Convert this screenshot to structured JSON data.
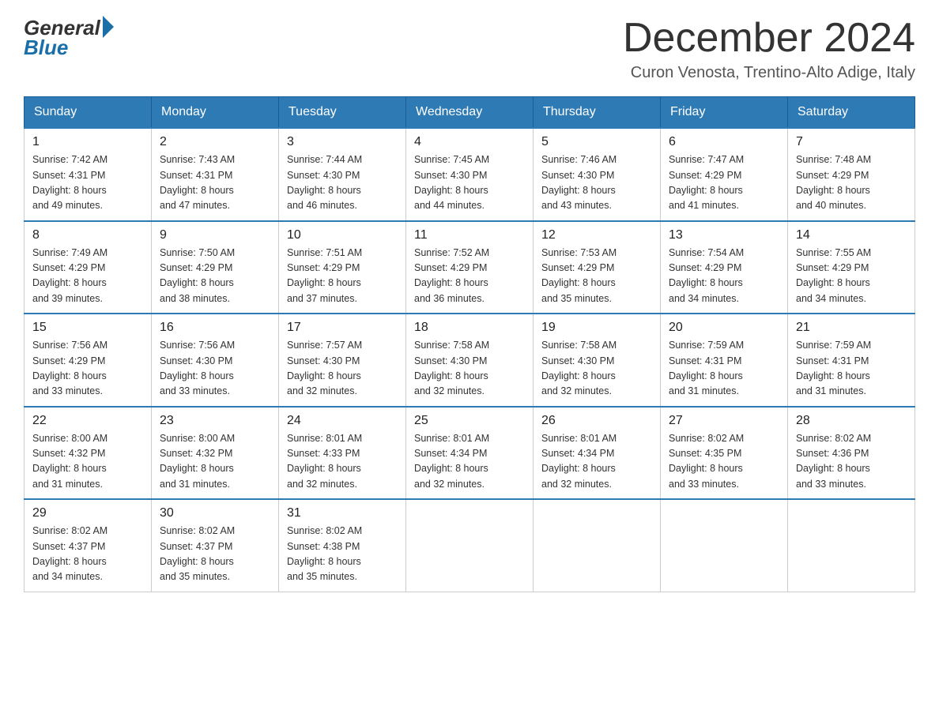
{
  "logo": {
    "general": "General",
    "blue": "Blue"
  },
  "title": {
    "month_year": "December 2024",
    "location": "Curon Venosta, Trentino-Alto Adige, Italy"
  },
  "headers": [
    "Sunday",
    "Monday",
    "Tuesday",
    "Wednesday",
    "Thursday",
    "Friday",
    "Saturday"
  ],
  "weeks": [
    [
      {
        "day": "1",
        "sunrise": "7:42 AM",
        "sunset": "4:31 PM",
        "daylight": "8 hours and 49 minutes."
      },
      {
        "day": "2",
        "sunrise": "7:43 AM",
        "sunset": "4:31 PM",
        "daylight": "8 hours and 47 minutes."
      },
      {
        "day": "3",
        "sunrise": "7:44 AM",
        "sunset": "4:30 PM",
        "daylight": "8 hours and 46 minutes."
      },
      {
        "day": "4",
        "sunrise": "7:45 AM",
        "sunset": "4:30 PM",
        "daylight": "8 hours and 44 minutes."
      },
      {
        "day": "5",
        "sunrise": "7:46 AM",
        "sunset": "4:30 PM",
        "daylight": "8 hours and 43 minutes."
      },
      {
        "day": "6",
        "sunrise": "7:47 AM",
        "sunset": "4:29 PM",
        "daylight": "8 hours and 41 minutes."
      },
      {
        "day": "7",
        "sunrise": "7:48 AM",
        "sunset": "4:29 PM",
        "daylight": "8 hours and 40 minutes."
      }
    ],
    [
      {
        "day": "8",
        "sunrise": "7:49 AM",
        "sunset": "4:29 PM",
        "daylight": "8 hours and 39 minutes."
      },
      {
        "day": "9",
        "sunrise": "7:50 AM",
        "sunset": "4:29 PM",
        "daylight": "8 hours and 38 minutes."
      },
      {
        "day": "10",
        "sunrise": "7:51 AM",
        "sunset": "4:29 PM",
        "daylight": "8 hours and 37 minutes."
      },
      {
        "day": "11",
        "sunrise": "7:52 AM",
        "sunset": "4:29 PM",
        "daylight": "8 hours and 36 minutes."
      },
      {
        "day": "12",
        "sunrise": "7:53 AM",
        "sunset": "4:29 PM",
        "daylight": "8 hours and 35 minutes."
      },
      {
        "day": "13",
        "sunrise": "7:54 AM",
        "sunset": "4:29 PM",
        "daylight": "8 hours and 34 minutes."
      },
      {
        "day": "14",
        "sunrise": "7:55 AM",
        "sunset": "4:29 PM",
        "daylight": "8 hours and 34 minutes."
      }
    ],
    [
      {
        "day": "15",
        "sunrise": "7:56 AM",
        "sunset": "4:29 PM",
        "daylight": "8 hours and 33 minutes."
      },
      {
        "day": "16",
        "sunrise": "7:56 AM",
        "sunset": "4:30 PM",
        "daylight": "8 hours and 33 minutes."
      },
      {
        "day": "17",
        "sunrise": "7:57 AM",
        "sunset": "4:30 PM",
        "daylight": "8 hours and 32 minutes."
      },
      {
        "day": "18",
        "sunrise": "7:58 AM",
        "sunset": "4:30 PM",
        "daylight": "8 hours and 32 minutes."
      },
      {
        "day": "19",
        "sunrise": "7:58 AM",
        "sunset": "4:30 PM",
        "daylight": "8 hours and 32 minutes."
      },
      {
        "day": "20",
        "sunrise": "7:59 AM",
        "sunset": "4:31 PM",
        "daylight": "8 hours and 31 minutes."
      },
      {
        "day": "21",
        "sunrise": "7:59 AM",
        "sunset": "4:31 PM",
        "daylight": "8 hours and 31 minutes."
      }
    ],
    [
      {
        "day": "22",
        "sunrise": "8:00 AM",
        "sunset": "4:32 PM",
        "daylight": "8 hours and 31 minutes."
      },
      {
        "day": "23",
        "sunrise": "8:00 AM",
        "sunset": "4:32 PM",
        "daylight": "8 hours and 31 minutes."
      },
      {
        "day": "24",
        "sunrise": "8:01 AM",
        "sunset": "4:33 PM",
        "daylight": "8 hours and 32 minutes."
      },
      {
        "day": "25",
        "sunrise": "8:01 AM",
        "sunset": "4:34 PM",
        "daylight": "8 hours and 32 minutes."
      },
      {
        "day": "26",
        "sunrise": "8:01 AM",
        "sunset": "4:34 PM",
        "daylight": "8 hours and 32 minutes."
      },
      {
        "day": "27",
        "sunrise": "8:02 AM",
        "sunset": "4:35 PM",
        "daylight": "8 hours and 33 minutes."
      },
      {
        "day": "28",
        "sunrise": "8:02 AM",
        "sunset": "4:36 PM",
        "daylight": "8 hours and 33 minutes."
      }
    ],
    [
      {
        "day": "29",
        "sunrise": "8:02 AM",
        "sunset": "4:37 PM",
        "daylight": "8 hours and 34 minutes."
      },
      {
        "day": "30",
        "sunrise": "8:02 AM",
        "sunset": "4:37 PM",
        "daylight": "8 hours and 35 minutes."
      },
      {
        "day": "31",
        "sunrise": "8:02 AM",
        "sunset": "4:38 PM",
        "daylight": "8 hours and 35 minutes."
      },
      null,
      null,
      null,
      null
    ]
  ]
}
